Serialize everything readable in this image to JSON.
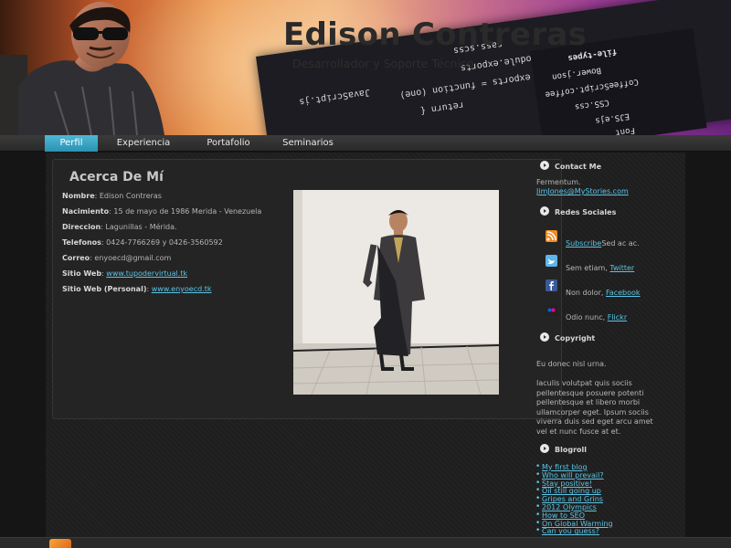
{
  "header": {
    "title": "Edison Contreras",
    "tagline": "Desarrollador y Soporte Técnico",
    "code_lines": [
      "return {",
      "exports = function (one)",
      "module.exports",
      "JavaScript.js",
      "sass.scss"
    ],
    "tree_lines": [
      "file-types",
      "Bower.json",
      "CoffeeScript.coffee",
      "CSS.css",
      "EJS.ejs",
      "Font"
    ]
  },
  "nav": {
    "tabs": [
      {
        "label": "Perfil",
        "active": true
      },
      {
        "label": "Experiencia",
        "active": false
      },
      {
        "label": "Portafolio",
        "active": false
      },
      {
        "label": "Seminarios",
        "active": false
      }
    ]
  },
  "main": {
    "title": "Acerca De Mí",
    "fields": [
      {
        "label": "Nombre",
        "value": ": Edison Contreras"
      },
      {
        "label": "Nacimiento",
        "value": ": 15 de mayo de 1986 Merida - Venezuela"
      },
      {
        "label": "Direccion",
        "value": ": Lagunillas - Mérida."
      },
      {
        "label": "Telefonos",
        "value": ": 0424-7766269 y 0426-3560592"
      },
      {
        "label": "Correo",
        "value": ": enyoecd@gmail.com"
      },
      {
        "label": "Sitio Web",
        "value": ": ",
        "link": "www.tupodervirtual.tk"
      },
      {
        "label": "Sitio Web (Personal)",
        "value": ": ",
        "link": "www.enyoecd.tk"
      }
    ]
  },
  "sidebar": {
    "contact": {
      "heading": "Contact Me",
      "text": "Fermentum.",
      "email": "JimJones@MyStories.com"
    },
    "social": {
      "heading": "Redes Sociales",
      "items": [
        {
          "icon": "rss-icon",
          "before": "",
          "link": "Subscribe",
          "after": "Sed ac ac.",
          "color": "#f08a24"
        },
        {
          "icon": "twitter-icon",
          "before": "Sem etiam, ",
          "link": "Twitter",
          "after": "",
          "color": "#5fb6e6"
        },
        {
          "icon": "facebook-icon",
          "before": "Non dolor, ",
          "link": "Facebook",
          "after": "",
          "color": "#3b5998"
        },
        {
          "icon": "flickr-icon",
          "before": "Odio nunc, ",
          "link": "Flickr",
          "after": "",
          "color": "#222222"
        }
      ]
    },
    "copyright": {
      "heading": "Copyright",
      "text1": "Eu donec nisl urna.",
      "text2_lines": [
        "Iaculis volutpat quis sociis",
        "pellentesque posuere potenti",
        "pellentesque et libero morbi",
        "ullamcorper eget. Ipsum sociis",
        "viverra duis sed eget arcu amet",
        "vel et nunc fusce at et."
      ]
    },
    "blogroll": {
      "heading": "Blogroll",
      "items": [
        "My first blog",
        "Who will prevail?",
        "Stay positive!",
        "Oil still going up",
        "Gripes and Grins",
        "2012 Olympics",
        "How to SEO",
        "On Global Warming",
        "Can you guess?"
      ]
    }
  },
  "colors": {
    "accent": "#2a93b3",
    "link": "#5bc4e6",
    "background": "#151515"
  }
}
